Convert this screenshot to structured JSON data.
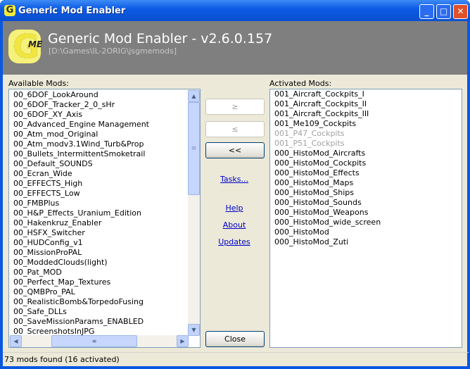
{
  "window": {
    "title": "Generic Mod Enabler",
    "icon": "G",
    "minimize": "_",
    "maximize": "□",
    "close": "✕"
  },
  "header": {
    "logo_g": "G",
    "logo_me": "ME",
    "title": "Generic Mod Enabler - v2.6.0.157",
    "path": "[D:\\Games\\IL-2ORIG\\jsgmemods]"
  },
  "available": {
    "label": "Available Mods:",
    "items": [
      "00_6DOF_LookAround",
      "00_6DOF_Tracker_2_0_sHr",
      "00_6DOF_XY_Axis",
      "00_Advanced_Engine Management",
      "00_Atm_mod_Original",
      "00_Atm_modv3.1Wind_Turb&Prop",
      "00_Bullets_IntermittentSmoketrail",
      "00_Default_SOUNDS",
      "00_Ecran_Wide",
      "00_EFFECTS_High",
      "00_EFFECTS_Low",
      "00_FMBPlus",
      "00_H&P_Effects_Uranium_Edition",
      "00_Hakenkruz_Enabler",
      "00_HSFX_Switcher",
      "00_HUDConfig_v1",
      "00_MissionProPAL",
      "00_ModdedClouds(light)",
      "00_Pat_MOD",
      "00_Perfect_Map_Textures",
      "00_QMBPro_PAL",
      "00_RealisticBomb&TorpedoFusing",
      "00_Safe_DLLs",
      "00_SaveMissionParams_ENABLED",
      "00_ScreenshotsInJPG"
    ]
  },
  "activated": {
    "label": "Activated Mods:",
    "items": [
      {
        "name": "001_Aircraft_Cockpits_I",
        "enabled": true
      },
      {
        "name": "001_Aircraft_Cockpits_II",
        "enabled": true
      },
      {
        "name": "001_Aircraft_Cockpits_III",
        "enabled": true
      },
      {
        "name": "001_Me109_Cockpits",
        "enabled": true
      },
      {
        "name": "001_P47_Cockpits",
        "enabled": false
      },
      {
        "name": "001_P51_Cockpits",
        "enabled": false
      },
      {
        "name": "000_HistoMod_Aircrafts",
        "enabled": true
      },
      {
        "name": "000_HistoMod_Cockpits",
        "enabled": true
      },
      {
        "name": "000_HistoMod_Effects",
        "enabled": true
      },
      {
        "name": "000_HistoMod_Maps",
        "enabled": true
      },
      {
        "name": "000_HistoMod_Ships",
        "enabled": true
      },
      {
        "name": "000_HistoMod_Sounds",
        "enabled": true
      },
      {
        "name": "000_HistoMod_Weapons",
        "enabled": true
      },
      {
        "name": "000_HistoMod_wide_screen",
        "enabled": true
      },
      {
        "name": "000_HistoMod",
        "enabled": true
      },
      {
        "name": "000_HistoMod_Zuti",
        "enabled": true
      }
    ]
  },
  "buttons": {
    "activate": "≥",
    "deactivate": "≤",
    "deactivate_all": "<<",
    "tasks": "Tasks...",
    "help": "Help",
    "about": "About",
    "updates": "Updates",
    "close": "Close"
  },
  "scroll": {
    "up": "▲",
    "down": "▼",
    "left": "◀",
    "right": "▶",
    "grip": "≡"
  },
  "status": "73 mods found (16 activated)"
}
